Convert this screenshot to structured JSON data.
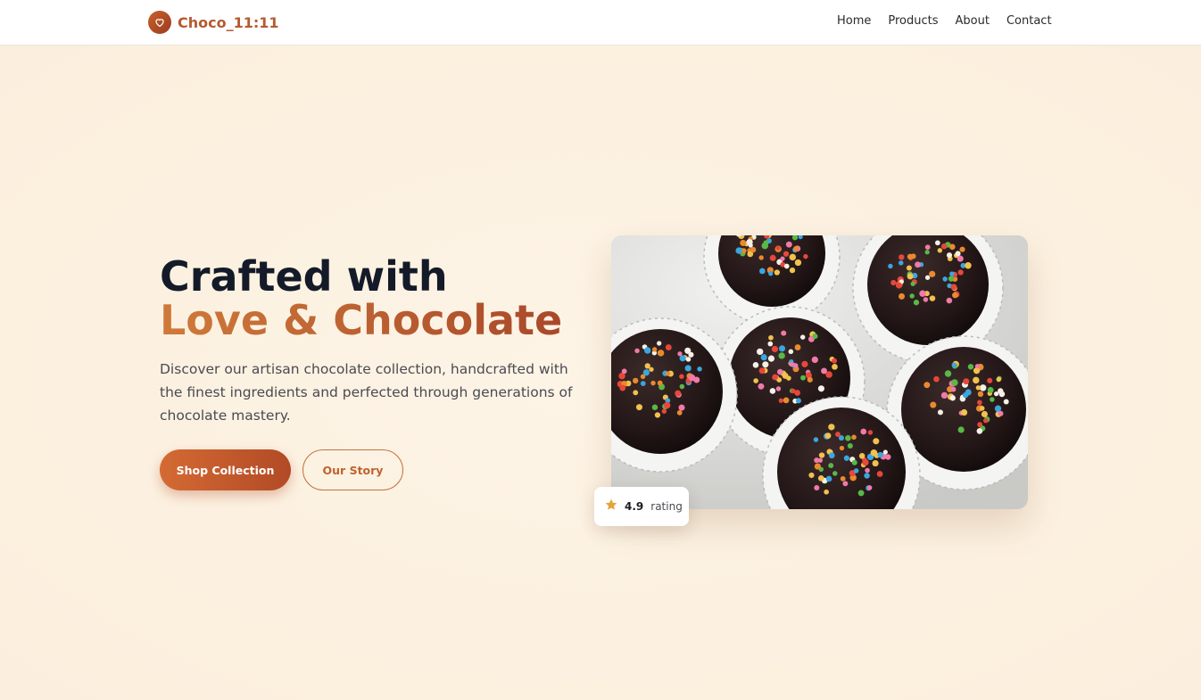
{
  "brand": {
    "name": "Choco_11:11",
    "logo_icon": "heart-icon"
  },
  "nav": {
    "items": [
      "Home",
      "Products",
      "About",
      "Contact"
    ]
  },
  "hero": {
    "headline_line1": "Crafted with",
    "headline_line2": "Love & Chocolate",
    "description": "Discover our artisan chocolate collection, handcrafted with the finest ingredients and perfected through generations of chocolate mastery.",
    "primary_button": "Shop Collection",
    "secondary_button": "Our Story"
  },
  "image": {
    "subject": "chocolate-truffles-with-rainbow-sprinkles-photo"
  },
  "rating": {
    "value": "4.9",
    "label": "rating",
    "icon": "star-icon"
  },
  "colors": {
    "accent": "#c0622f",
    "accent_dark": "#a9482a",
    "headline_dark": "#141a28",
    "background": "#fcf3e4",
    "star": "#e0a63a"
  }
}
